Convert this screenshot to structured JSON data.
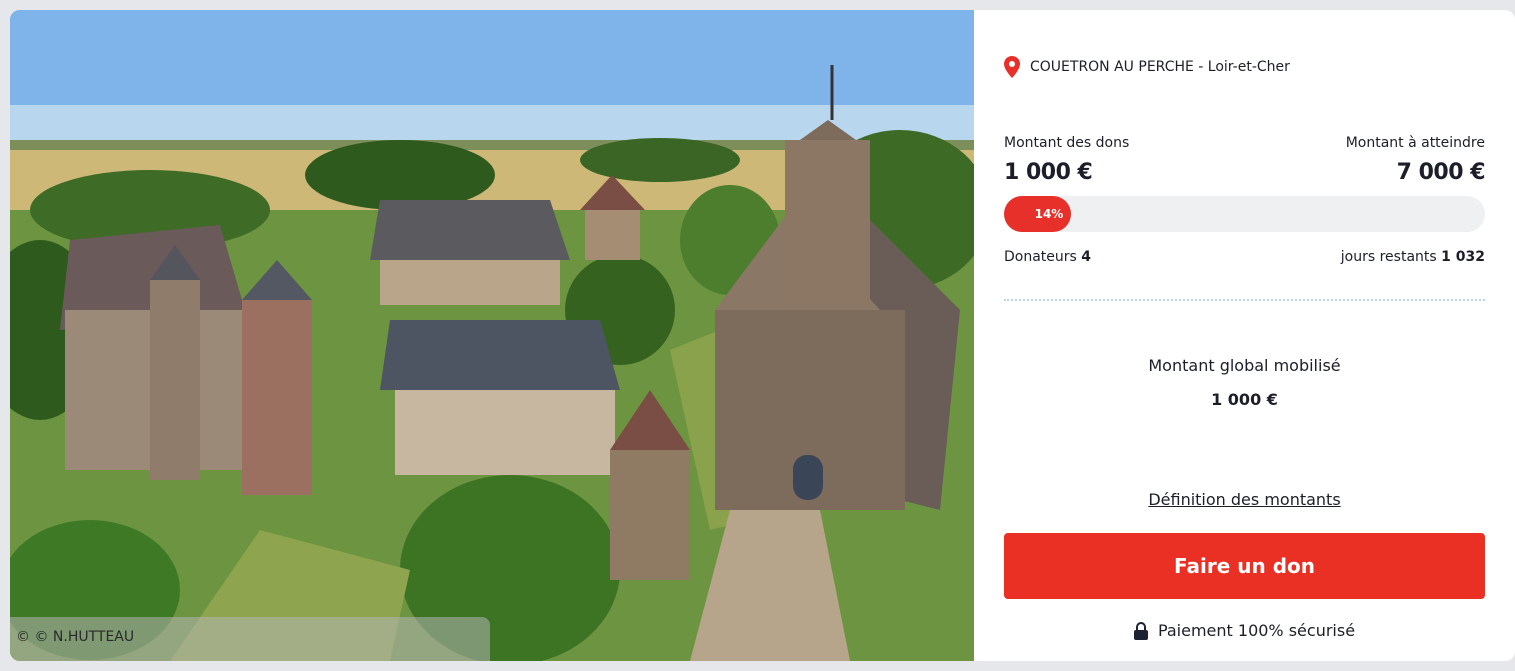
{
  "photo": {
    "credit": "© © N.HUTTEAU"
  },
  "location": {
    "icon": "location-pin-icon",
    "text": "COUETRON AU PERCHE - Loir-et-Cher"
  },
  "donations": {
    "raised_label": "Montant des dons",
    "raised_value": "1 000 €",
    "goal_label": "Montant à atteindre",
    "goal_value": "7 000 €",
    "progress_percent": 14,
    "progress_label": "14%",
    "donors_label": "Donateurs",
    "donors_value": "4",
    "days_label": "jours restants",
    "days_value": "1 032"
  },
  "global": {
    "label": "Montant global mobilisé",
    "value": "1 000 €"
  },
  "definition_link": "Définition des montants",
  "donate_button": "Faire un don",
  "secure": {
    "icon": "lock-icon",
    "text": "Paiement 100% sécurisé"
  },
  "colors": {
    "accent": "#ea2f24",
    "track": "#eef0f2"
  }
}
